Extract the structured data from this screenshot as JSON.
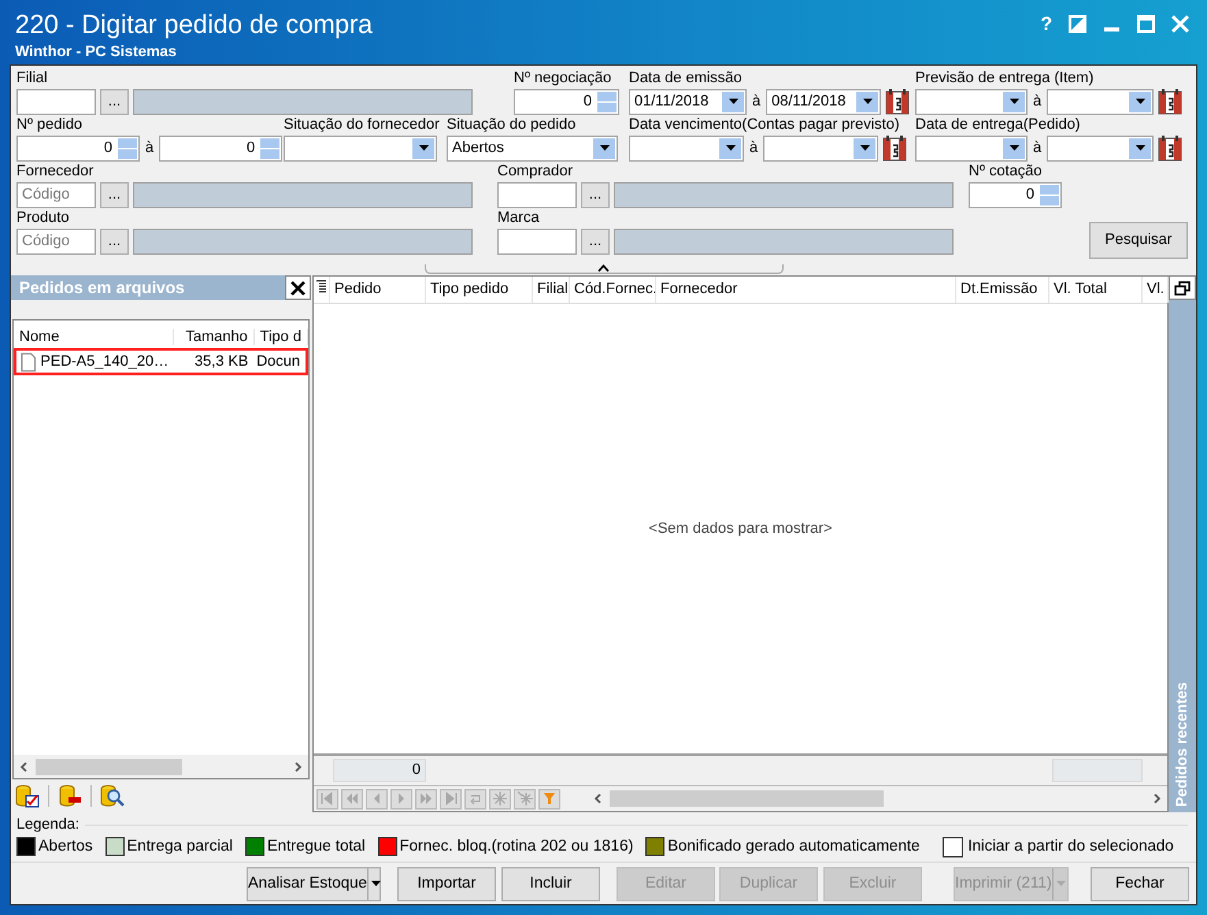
{
  "window": {
    "title": "220 - Digitar pedido de compra",
    "subtitle": "Winthor - PC Sistemas",
    "help": "?"
  },
  "filter_rows": [
    [
      {
        "label": "Filial",
        "controls": [
          {
            "kind": "text"
          },
          {
            "kind": "ellipsis",
            "label": "..."
          },
          {
            "kind": "readonly"
          }
        ]
      },
      {
        "label": "Nº negociação",
        "controls": [
          {
            "kind": "spin",
            "value": "0"
          }
        ]
      },
      {
        "label": "Data de emissão",
        "controls": [
          {
            "kind": "combo",
            "value": "01/11/2018"
          },
          {
            "kind": "sep",
            "label": "à"
          },
          {
            "kind": "combo",
            "value": "08/11/2018"
          },
          {
            "kind": "calendar"
          }
        ]
      },
      {
        "label": "Previsão  de entrega (Item)",
        "controls": [
          {
            "kind": "combo"
          },
          {
            "kind": "sep",
            "label": "à"
          },
          {
            "kind": "combo"
          },
          {
            "kind": "calendar"
          }
        ]
      }
    ],
    [
      {
        "label": "Nº pedido",
        "controls": [
          {
            "kind": "spin",
            "value": "0"
          },
          {
            "kind": "sep",
            "label": "à"
          },
          {
            "kind": "spin",
            "value": "0"
          }
        ]
      },
      {
        "label": "Situação do fornecedor",
        "controls": [
          {
            "kind": "combo"
          }
        ]
      },
      {
        "label": "Situação do pedido",
        "controls": [
          {
            "kind": "combo",
            "value": "Abertos"
          }
        ]
      },
      {
        "label": "Data vencimento(Contas pagar previsto)",
        "controls": [
          {
            "kind": "combo"
          },
          {
            "kind": "sep",
            "label": "à"
          },
          {
            "kind": "combo"
          },
          {
            "kind": "calendar"
          }
        ]
      },
      {
        "label": "Data de entrega(Pedido)",
        "controls": [
          {
            "kind": "combo"
          },
          {
            "kind": "sep",
            "label": "à"
          },
          {
            "kind": "combo"
          },
          {
            "kind": "calendar"
          }
        ]
      }
    ],
    [
      {
        "label": "Fornecedor",
        "controls": [
          {
            "kind": "text",
            "placeholder": "Código"
          },
          {
            "kind": "ellipsis",
            "label": "..."
          },
          {
            "kind": "readonly"
          }
        ]
      },
      {
        "label": "Comprador",
        "controls": [
          {
            "kind": "text"
          },
          {
            "kind": "ellipsis",
            "label": "..."
          },
          {
            "kind": "readonly"
          }
        ]
      },
      {
        "label": "Nº cotação",
        "controls": [
          {
            "kind": "spin",
            "value": "0"
          }
        ]
      }
    ],
    [
      {
        "label": "Produto",
        "controls": [
          {
            "kind": "text",
            "placeholder": "Código"
          },
          {
            "kind": "ellipsis",
            "label": "..."
          },
          {
            "kind": "readonly"
          }
        ]
      },
      {
        "label": "Marca",
        "controls": [
          {
            "kind": "text"
          },
          {
            "kind": "ellipsis",
            "label": "..."
          },
          {
            "kind": "readonly"
          }
        ]
      },
      {
        "controls": [
          {
            "kind": "button",
            "label": "Pesquisar"
          }
        ]
      }
    ]
  ],
  "files_panel": {
    "title": "Pedidos em arquivos",
    "columns": [
      "Nome",
      "Tamanho",
      "Tipo d"
    ],
    "rows": [
      {
        "cells": [
          "PED-A5_140_20…",
          "35,3 KB",
          "Docun"
        ],
        "highlighted": true
      }
    ]
  },
  "orders_grid": {
    "columns": [
      "Pedido",
      "Tipo pedido",
      "Filial",
      "Cód.Fornec.",
      "Fornecedor",
      "Dt.Emissão",
      "Vl. Total",
      "Vl."
    ],
    "empty_text": "<Sem dados para mostrar>",
    "summary": "0"
  },
  "side_tab": {
    "label": "Pedidos recentes"
  },
  "legend": {
    "title": "Legenda:",
    "items": [
      {
        "label": "Abertos",
        "color": "#000000"
      },
      {
        "label": "Entrega parcial",
        "color": "#c8dcc8"
      },
      {
        "label": "Entregue total",
        "color": "#008000"
      },
      {
        "label": "Fornec. bloq.(rotina 202 ou 1816)",
        "color": "#ff0000"
      },
      {
        "label": "Bonificado gerado automaticamente",
        "color": "#808000"
      }
    ],
    "checkbox": {
      "label": "Iniciar a partir do selecionado",
      "checked": false
    }
  },
  "buttons": [
    {
      "label": "Analisar Estoque",
      "disabled": false,
      "kind": "split"
    },
    {
      "label": "Importar",
      "disabled": false,
      "kind": "plain"
    },
    {
      "label": "Incluir",
      "disabled": false,
      "kind": "plain"
    },
    {
      "label": "Editar",
      "disabled": true,
      "kind": "plain"
    },
    {
      "label": "Duplicar",
      "disabled": true,
      "kind": "plain"
    },
    {
      "label": "Excluir",
      "disabled": true,
      "kind": "plain"
    },
    {
      "label": "Imprimir (211)",
      "disabled": true,
      "kind": "split"
    },
    {
      "label": "Fechar",
      "disabled": false,
      "kind": "plain"
    }
  ]
}
